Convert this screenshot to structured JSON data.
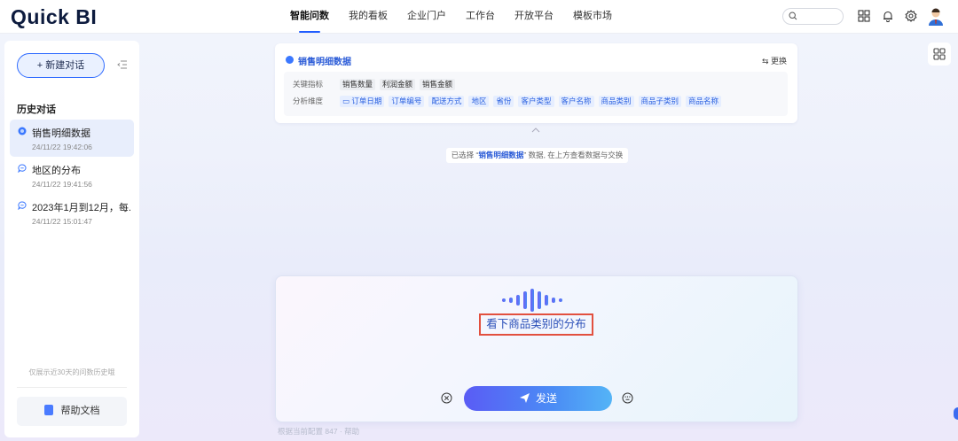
{
  "header": {
    "logo": "Quick BI",
    "nav": [
      "智能问数",
      "我的看板",
      "企业门户",
      "工作台",
      "开放平台",
      "模板市场"
    ],
    "active_nav": "智能问数"
  },
  "sidebar": {
    "new_chat": "+ 新建对话",
    "section_title": "历史对话",
    "items": [
      {
        "title": "销售明细数据",
        "date": "24/11/22 19:42:06"
      },
      {
        "title": "地区的分布",
        "date": "24/11/22 19:41:56"
      },
      {
        "title": "2023年1月到12月，每...",
        "date": "24/11/22 15:01:47"
      }
    ],
    "hint": "仅展示近30天的问数历史哦",
    "help": "帮助文档"
  },
  "dataset": {
    "title": "销售明细数据",
    "swap": "⇆ 更换",
    "metrics_label": "关键指标",
    "metrics": [
      "销售数量",
      "利润金额",
      "销售金额"
    ],
    "dims_label": "分析维度",
    "dims": [
      "订单日期",
      "订单编号",
      "配送方式",
      "地区",
      "省份",
      "客户类型",
      "客户名称",
      "商品类别",
      "商品子类别",
      "商品名称"
    ]
  },
  "status": {
    "prefix": "已选择 “",
    "name": "销售明细数据",
    "suffix": "” 数据, 在上方查看数据与交换"
  },
  "voice": {
    "transcript": "看下商品类别的分布",
    "send": "发送"
  },
  "footer": {
    "text": "根据当前配置 847 · 帮助"
  },
  "colors": {
    "accent": "#1f5cff",
    "send_start": "#5a5cf5",
    "send_end": "#54b4f6",
    "highlight": "#e2503f"
  }
}
